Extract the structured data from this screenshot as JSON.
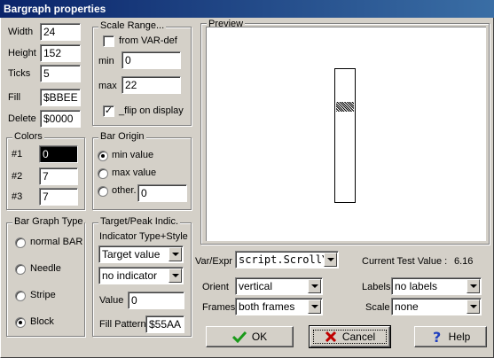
{
  "window": {
    "title": "Bargraph properties"
  },
  "fields": {
    "width": {
      "label": "Width",
      "value": "24"
    },
    "height": {
      "label": "Height",
      "value": "152"
    },
    "ticks": {
      "label": "Ticks",
      "value": "5"
    },
    "fill": {
      "label": "Fill",
      "value": "$BBEE"
    },
    "delete": {
      "label": "Delete",
      "value": "$0000"
    }
  },
  "colors": {
    "title": "Colors",
    "c1": {
      "label": "#1",
      "value": "0"
    },
    "c2": {
      "label": "#2",
      "value": "7"
    },
    "c3": {
      "label": "#3",
      "value": "7"
    }
  },
  "bar_graph_type": {
    "title": "Bar Graph Type",
    "options": [
      "normal BAR",
      "Needle",
      "Stripe",
      "Block"
    ],
    "selected": "Block"
  },
  "scale_range": {
    "title": "Scale Range...",
    "from_var_def": {
      "label": "from VAR-def",
      "checked": false
    },
    "min": {
      "label": "min",
      "value": "0"
    },
    "max": {
      "label": "max",
      "value": "22"
    },
    "flip": {
      "label": "_flip on display",
      "checked": true
    }
  },
  "bar_origin": {
    "title": "Bar Origin",
    "options": [
      "min value",
      "max value",
      "other."
    ],
    "selected": "min value",
    "other_value": "0"
  },
  "target_peak": {
    "title": "Target/Peak Indic.",
    "subtitle": "Indicator Type+Style",
    "type_value": "Target value",
    "style_value": "no indicator",
    "value_label": "Value",
    "value": "0",
    "fill_pattern_label": "Fill Pattern",
    "fill_pattern": "$55AA"
  },
  "preview": {
    "title": "Preview"
  },
  "var_expr": {
    "label": "Var/Expr",
    "value": "script.ScrollY"
  },
  "current_test": {
    "label": "Current Test Value :",
    "value": "6.16"
  },
  "orient": {
    "label": "Orient",
    "value": "vertical"
  },
  "frames": {
    "label": "Frames",
    "value": "both frames"
  },
  "labels": {
    "label": "Labels",
    "value": "no labels"
  },
  "scale": {
    "label": "Scale",
    "value": "none"
  },
  "buttons": {
    "ok": "OK",
    "cancel": "Cancel",
    "help": "Help"
  }
}
